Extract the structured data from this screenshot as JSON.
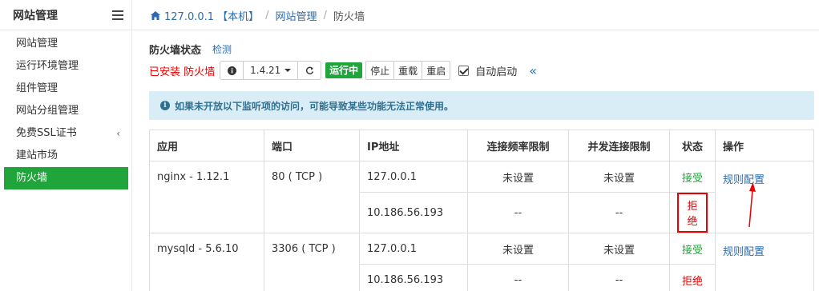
{
  "sidebar": {
    "title": "网站管理",
    "items": [
      {
        "label": "网站管理",
        "chevron": ""
      },
      {
        "label": "运行环境管理",
        "chevron": ""
      },
      {
        "label": "组件管理",
        "chevron": ""
      },
      {
        "label": "网站分组管理",
        "chevron": ""
      },
      {
        "label": "免费SSL证书",
        "chevron": "‹"
      },
      {
        "label": "建站市场",
        "chevron": ""
      },
      {
        "label": "防火墙",
        "chevron": ""
      }
    ],
    "active_index": 6
  },
  "breadcrumb": {
    "host": "127.0.0.1 【本机】",
    "section": "网站管理",
    "current": "防火墙"
  },
  "firewall": {
    "status_title": "防火墙状态",
    "check_link": "检测",
    "installed_text": "已安装 防火墙",
    "version": "1.4.21",
    "running_badge": "运行中",
    "controls": [
      "停止",
      "重载",
      "重启"
    ],
    "autostart_label": "自动启动",
    "autostart_checked": true
  },
  "alert": {
    "text": "如果未开放以下监听项的访问，可能导致某些功能无法正常使用。"
  },
  "table": {
    "headers": [
      "应用",
      "端口",
      "IP地址",
      "连接频率限制",
      "并发连接限制",
      "状态",
      "操作"
    ],
    "groups": [
      {
        "app": "nginx - 1.12.1",
        "port": "80 ( TCP )",
        "action": "规则配置",
        "rows": [
          {
            "ip": "127.0.0.1",
            "rate": "未设置",
            "conn": "未设置",
            "status": "接受"
          },
          {
            "ip": "10.186.56.193",
            "rate": "--",
            "conn": "--",
            "status": "拒绝"
          }
        ]
      },
      {
        "app": "mysqld - 5.6.10",
        "port": "3306 ( TCP )",
        "action": "规则配置",
        "rows": [
          {
            "ip": "127.0.0.1",
            "rate": "未设置",
            "conn": "未设置",
            "status": "接受"
          },
          {
            "ip": "10.186.56.193",
            "rate": "--",
            "conn": "--",
            "status": "拒绝"
          }
        ]
      }
    ]
  },
  "colors": {
    "accent_green": "#20a53a",
    "link_blue": "#2b6cb0",
    "error_red": "#e00000",
    "alert_bg": "#d9edf7"
  }
}
